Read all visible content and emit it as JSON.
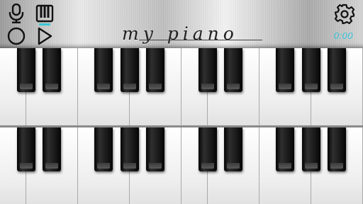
{
  "app": {
    "title": "my piano",
    "timer": "0:00"
  },
  "toolbar": {
    "buttons": [
      {
        "name": "microphone-icon"
      },
      {
        "name": "piano-keys-icon",
        "selected": true
      },
      {
        "name": "record-icon"
      },
      {
        "name": "play-icon"
      },
      {
        "name": "gear-icon"
      }
    ],
    "accent_color": "#35c3d8"
  },
  "keyboards": [
    {
      "name": "upper-keyboard",
      "white_keys": 14,
      "black_key_pattern": [
        1,
        1,
        0,
        1,
        1,
        1,
        0,
        1,
        1,
        0,
        1,
        1,
        1
      ]
    },
    {
      "name": "lower-keyboard",
      "white_keys": 14,
      "black_key_pattern": [
        1,
        1,
        0,
        1,
        1,
        1,
        0,
        1,
        1,
        0,
        1,
        1,
        1
      ]
    }
  ]
}
